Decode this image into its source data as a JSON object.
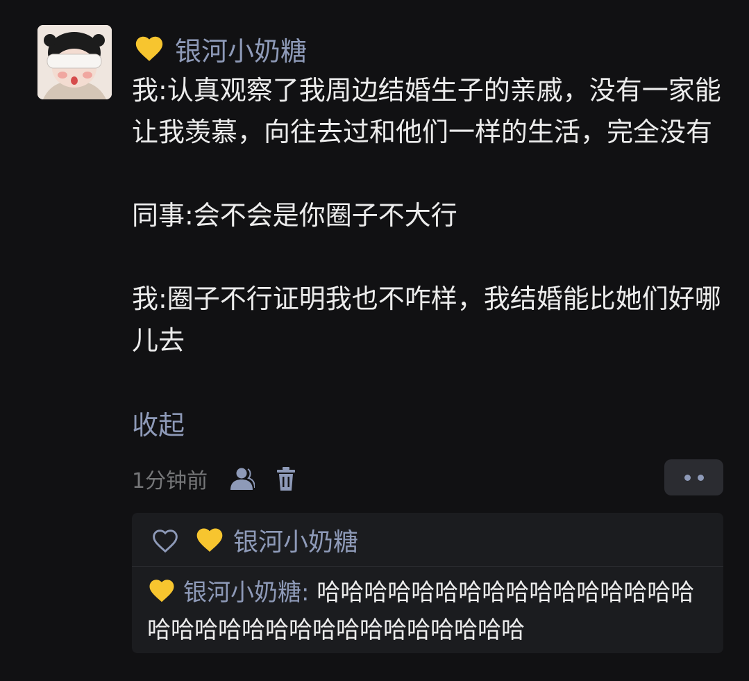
{
  "post": {
    "author": "银河小奶糖",
    "paragraphs": [
      "我:认真观察了我周边结婚生子的亲戚，没有一家能让我羡慕，向往去过和他们一样的生活，完全没有",
      "同事:会不会是你圈子不大行",
      "我:圈子不行证明我也不咋样，我结婚能比她们好哪儿去"
    ],
    "collapse_label": "收起",
    "timestamp": "1分钟前"
  },
  "icons": {
    "author_badge": "yellow-heart-icon",
    "visibility": "person-icon",
    "delete": "trash-icon",
    "more": "more-dots-icon",
    "like": "heart-outline-icon"
  },
  "reply": {
    "liker": "银河小奶糖",
    "comment": {
      "author": "银河小奶糖",
      "separator": ": ",
      "text": "哈哈哈哈哈哈哈哈哈哈哈哈哈哈哈哈哈哈哈哈哈哈哈哈哈哈哈哈哈哈哈哈"
    }
  },
  "colors": {
    "background": "#111113",
    "link": "#8e9ab8",
    "text": "#ececec",
    "muted": "#767779",
    "heart": "#f7c52f"
  }
}
